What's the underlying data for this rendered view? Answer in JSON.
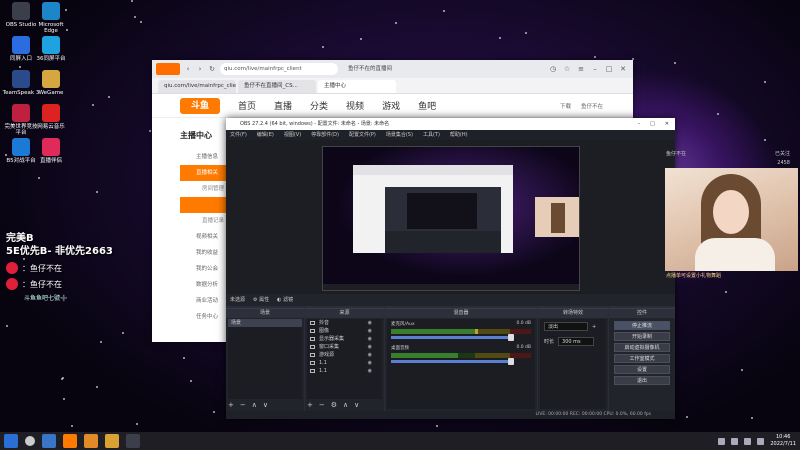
{
  "desktop": {
    "icons": [
      {
        "label": "OBS Studio",
        "icon": "obs-icon",
        "color": "#3b3f4c"
      },
      {
        "label": "Microsoft Edge",
        "icon": "edge-icon",
        "color": "#1d86c9"
      },
      {
        "label": "同屏入口",
        "icon": "screen-icon",
        "color": "#2b6de0"
      },
      {
        "label": "36同屏平台",
        "icon": "app-icon",
        "color": "#1ea3e0"
      },
      {
        "label": "TeamSpeak 3",
        "icon": "teamspeak-icon",
        "color": "#2b4a8a"
      },
      {
        "label": "WeGame",
        "icon": "wegame-icon",
        "color": "#d6a640"
      },
      {
        "label": "完美世界竞技平台",
        "icon": "perfect-world-icon",
        "color": "#c02040"
      },
      {
        "label": "网易云音乐",
        "icon": "netease-music-icon",
        "color": "#d22"
      },
      {
        "label": "B5对战平台",
        "icon": "b5-icon",
        "color": "#1a7ad6"
      },
      {
        "label": "直播伴侣",
        "icon": "live-companion-icon",
        "color": "#e02a5a"
      }
    ]
  },
  "overlay": {
    "line1": "完美B",
    "line2": "5E优先B-  非优先2663",
    "weibo_row": "：鱼仔不在",
    "weibo2_row": "：鱼仔不在",
    "small_line": "斗鱼鱼吧七號➕"
  },
  "browser": {
    "url": "qiu.com/live/mainfrpc_client",
    "top_tab": "鱼仔不在的直播间",
    "tabs": [
      "qiu.com/live/mainfrpc_client",
      "鱼仔不在直播间_CS...",
      "主播中心"
    ],
    "site_logo": "斗鱼",
    "nav": [
      "首页",
      "直播",
      "分类",
      "视频",
      "游戏",
      "鱼吧"
    ],
    "nav_right": [
      "下载",
      "鱼仔不在"
    ],
    "sidebar_title": "主播中心",
    "sidebar_items": [
      {
        "label": "主播信息",
        "active": false,
        "sub": false
      },
      {
        "label": "直播相关",
        "active": true,
        "sub": false
      },
      {
        "label": "房间管理",
        "active": false,
        "sub": true
      },
      {
        "label": "直播设置",
        "active": false,
        "sub": true,
        "highlight": true
      },
      {
        "label": "直播记录",
        "active": false,
        "sub": true
      },
      {
        "label": "视频相关",
        "active": false,
        "sub": false
      },
      {
        "label": "我的收益",
        "active": false,
        "sub": false
      },
      {
        "label": "我的公会",
        "active": false,
        "sub": false
      },
      {
        "label": "数据分析",
        "active": false,
        "sub": false
      },
      {
        "label": "商业活动",
        "active": false,
        "sub": false
      },
      {
        "label": "任务中心",
        "active": false,
        "sub": false
      }
    ]
  },
  "obs": {
    "title": "OBS 27.2.4 (64 bit, windows) - 配置文件: 未命名 - 场景: 未命名",
    "menu": [
      "文件(F)",
      "编辑(E)",
      "视图(V)",
      "停靠部件(D)",
      "配置文件(P)",
      "场景集合(S)",
      "工具(T)",
      "帮助(H)"
    ],
    "scene_bar": {
      "label": "未选源",
      "properties": "属性",
      "filters": "滤镜"
    },
    "docks": {
      "scenes": "场景",
      "sources": "来源",
      "mixer": "混音器",
      "transitions": "转场特效",
      "controls": "控件"
    },
    "scenes": [
      "场景"
    ],
    "sources": [
      "抖音",
      "图像",
      "显示器采集",
      "窗口采集",
      "游戏源",
      "1.1",
      "1.1"
    ],
    "mixer": [
      {
        "name": "麦克风/Aux",
        "db": "0.0 dB",
        "level": 0.62
      },
      {
        "name": "桌面音频",
        "db": "0.0 dB",
        "level": 0.48
      }
    ],
    "transition": {
      "type": "淡出",
      "duration_label": "时长",
      "duration": "300 ms"
    },
    "controls": [
      {
        "label": "停止推流",
        "on": true
      },
      {
        "label": "开始录制",
        "on": false
      },
      {
        "label": "启动虚拟摄像机",
        "on": false
      },
      {
        "label": "工作室模式",
        "on": false
      },
      {
        "label": "设置",
        "on": false
      },
      {
        "label": "退出",
        "on": false
      }
    ],
    "status": "LIVE: 00:00:00   REC: 00:00:00   CPU: 0.0%, 60.00 fps"
  },
  "cam": {
    "header_left": "鱼仔不在",
    "header_right": "已关注",
    "views": "2458",
    "caption": "点播单可设置小礼物舞蹈"
  },
  "taskbar": {
    "time": "10:46",
    "date": "2022/7/11"
  }
}
